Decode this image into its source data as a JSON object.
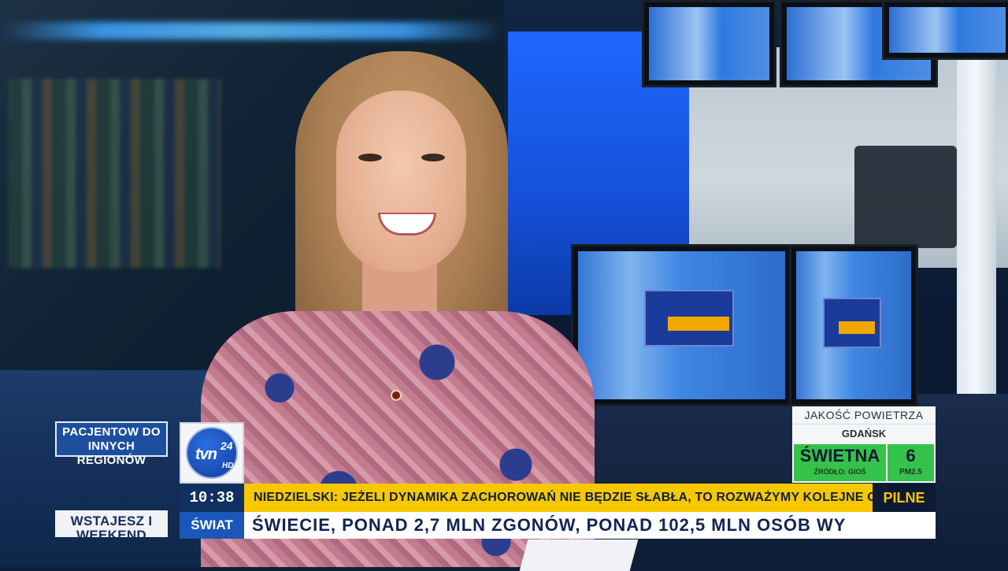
{
  "broadcast": {
    "channel_logo": {
      "brand": "tvn",
      "number": "24",
      "hd": "HD"
    },
    "clock": "10:38",
    "headline": "NIEDZIELSKI: JEŻELI DYNAMIKA ZACHOROWAŃ NIE BĘDZIE SŁABŁA, TO ROZWAŻYMY KOLEJNE OBOSTRZENIA",
    "urgent_tag": "PILNE",
    "ticker_section": "ŚWIAT",
    "ticker_text": "ŚWIECIE, PONAD 2,7 MLN ZGONÓW, PONAD 102,5 MLN OSÓB WY",
    "side_labels": {
      "story_teaser": "PACJENTOW DO INNYCH REGIONÓW",
      "show_name": "WSTAJESZ I WEEKEND"
    },
    "air_quality": {
      "title": "JAKOŚĆ POWIETRZA",
      "city": "GDAŃSK",
      "rating": "ŚWIETNA",
      "source": "ŹRÓDŁO: GIOŚ",
      "index_value": "6",
      "index_unit": "PM2.5"
    }
  },
  "colors": {
    "headline_bg": "#f7c800",
    "urgent_bg": "#0e1a33",
    "section_bg": "#1a57b8",
    "clock_bg": "#10305f",
    "aq_good": "#35c24a"
  }
}
